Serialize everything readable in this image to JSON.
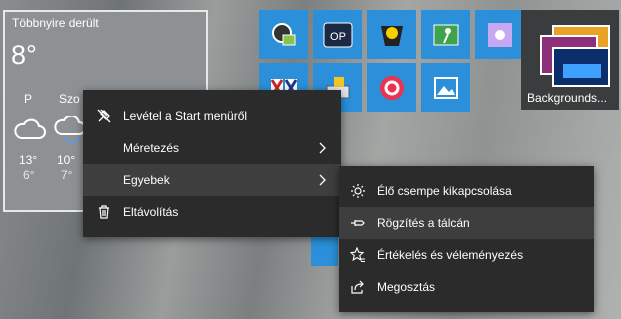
{
  "weather": {
    "condition": "Többnyire derült",
    "temperature": "8°",
    "days": [
      {
        "day": "P",
        "high": "13°",
        "low": "6°"
      },
      {
        "day": "Szo",
        "high": "10°",
        "low": "7°"
      }
    ]
  },
  "tiles": {
    "backgrounds_label": "Backgrounds..."
  },
  "context_menu": {
    "items": [
      {
        "label": "Levétel a Start menüről",
        "icon": "unpin-icon"
      },
      {
        "label": "Méretezés",
        "icon": "",
        "submenu": true
      },
      {
        "label": "Egyebek",
        "icon": "",
        "submenu": true
      },
      {
        "label": "Eltávolítás",
        "icon": "trash-icon"
      }
    ]
  },
  "submenu": {
    "items": [
      {
        "label": "Élő csempe kikapcsolása",
        "icon": "live-tile-icon"
      },
      {
        "label": "Rögzítés a tálcán",
        "icon": "pin-icon"
      },
      {
        "label": "Értékelés és véleményezés",
        "icon": "rate-star-icon"
      },
      {
        "label": "Megosztás",
        "icon": "share-icon"
      }
    ]
  },
  "colors": {
    "tile_blue": "#2b90d9",
    "menu_bg": "#2b2b2b",
    "menu_hover": "#3e3e3e"
  }
}
